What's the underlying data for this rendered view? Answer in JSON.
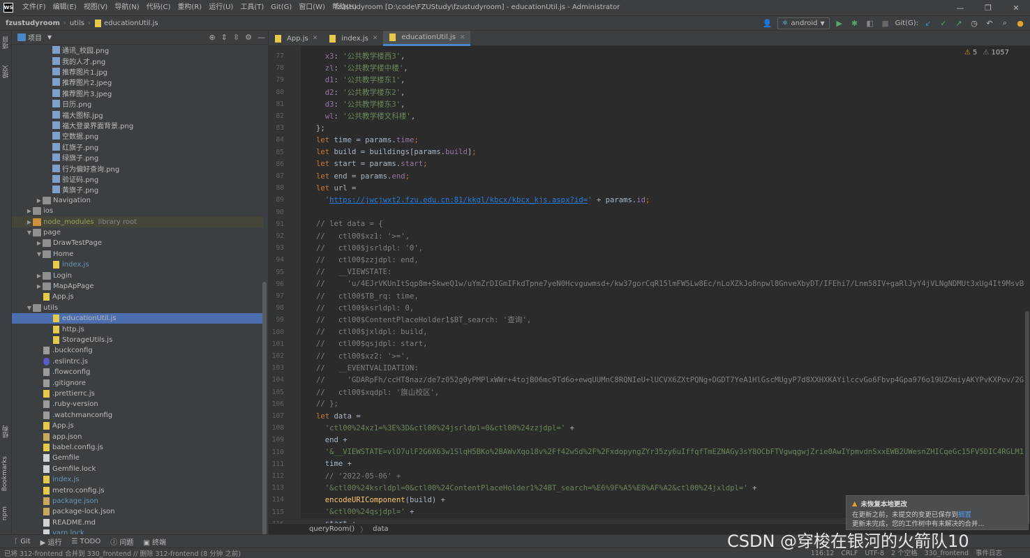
{
  "window": {
    "logo": "WS",
    "menu": [
      "文件(F)",
      "编辑(E)",
      "视图(V)",
      "导航(N)",
      "代码(C)",
      "重构(R)",
      "运行(U)",
      "工具(T)",
      "Git(G)",
      "窗口(W)",
      "帮助(H)"
    ],
    "title": "fzustudyroom [D:\\code\\FZUStudy\\fzustudyroom] - educationUtil.js - Administrator"
  },
  "navbar": {
    "crumbs": [
      "fzustudyroom",
      "utils",
      "educationUtil.js"
    ],
    "run_config": "android",
    "git_label": "Git(G):"
  },
  "left_strip": {
    "project_tab": "项目",
    "commit_tab": "提交",
    "structure_tab": "结构",
    "bookmarks_tab": "Bookmarks",
    "npm_tab": "npm"
  },
  "project_panel": {
    "title": "项目",
    "tree": [
      {
        "label": "通讯_校园.png",
        "type": "img",
        "indent": 3
      },
      {
        "label": "我的人才.png",
        "type": "img",
        "indent": 3
      },
      {
        "label": "推荐图片1.jpg",
        "type": "img",
        "indent": 3
      },
      {
        "label": "推荐图片2.jpeg",
        "type": "img",
        "indent": 3
      },
      {
        "label": "推荐图片3.jpeg",
        "type": "img",
        "indent": 3
      },
      {
        "label": "日历.png",
        "type": "img",
        "indent": 3
      },
      {
        "label": "福大图标.jpg",
        "type": "img",
        "indent": 3
      },
      {
        "label": "福大登录界面背景.png",
        "type": "img",
        "indent": 3
      },
      {
        "label": "空数据.png",
        "type": "img",
        "indent": 3
      },
      {
        "label": "红旗子.png",
        "type": "img",
        "indent": 3
      },
      {
        "label": "绿旗子.png",
        "type": "img",
        "indent": 3
      },
      {
        "label": "行为偏好查询.png",
        "type": "img",
        "indent": 3
      },
      {
        "label": "验证码.png",
        "type": "img",
        "indent": 3
      },
      {
        "label": "黄旗子.png",
        "type": "img",
        "indent": 3
      },
      {
        "label": "Navigation",
        "type": "folder",
        "indent": 2,
        "arrow": "▶"
      },
      {
        "label": "ios",
        "type": "folder",
        "indent": 1,
        "arrow": "▶"
      },
      {
        "label": "node_modules",
        "type": "folder-orange",
        "indent": 1,
        "arrow": "▶",
        "suffix": "library root",
        "lib": true
      },
      {
        "label": "page",
        "type": "folder",
        "indent": 1,
        "arrow": "▼"
      },
      {
        "label": "DrawTestPage",
        "type": "folder",
        "indent": 2,
        "arrow": "▶"
      },
      {
        "label": "Home",
        "type": "folder",
        "indent": 2,
        "arrow": "▼"
      },
      {
        "label": "index.js",
        "type": "js",
        "indent": 3,
        "blue": true
      },
      {
        "label": "Login",
        "type": "folder",
        "indent": 2,
        "arrow": "▶"
      },
      {
        "label": "MapApPage",
        "type": "folder",
        "indent": 2,
        "arrow": "▶"
      },
      {
        "label": "App.js",
        "type": "js",
        "indent": 2
      },
      {
        "label": "utils",
        "type": "folder",
        "indent": 1,
        "arrow": "▼"
      },
      {
        "label": "educationUtil.js",
        "type": "js",
        "indent": 3,
        "selected": true
      },
      {
        "label": "http.js",
        "type": "js",
        "indent": 3
      },
      {
        "label": "StorageUtils.js",
        "type": "js",
        "indent": 3
      },
      {
        "label": ".buckconfig",
        "type": "conf",
        "indent": 2
      },
      {
        "label": ".eslintrc.js",
        "type": "eslint",
        "indent": 2
      },
      {
        "label": ".flowconfig",
        "type": "conf",
        "indent": 2
      },
      {
        "label": ".gitignore",
        "type": "conf",
        "indent": 2
      },
      {
        "label": ".prettierrc.js",
        "type": "js",
        "indent": 2
      },
      {
        "label": ".ruby-version",
        "type": "conf",
        "indent": 2
      },
      {
        "label": ".watchmanconfig",
        "type": "conf",
        "indent": 2
      },
      {
        "label": "App.js",
        "type": "js",
        "indent": 2
      },
      {
        "label": "app.json",
        "type": "json",
        "indent": 2
      },
      {
        "label": "babel.config.js",
        "type": "js",
        "indent": 2
      },
      {
        "label": "Gemfile",
        "type": "file",
        "indent": 2
      },
      {
        "label": "Gemfile.lock",
        "type": "file",
        "indent": 2
      },
      {
        "label": "index.js",
        "type": "js",
        "indent": 2,
        "blue": true
      },
      {
        "label": "metro.config.js",
        "type": "js",
        "indent": 2
      },
      {
        "label": "package.json",
        "type": "json",
        "indent": 2,
        "blue": true
      },
      {
        "label": "package-lock.json",
        "type": "json",
        "indent": 2
      },
      {
        "label": "README.md",
        "type": "file",
        "indent": 2
      },
      {
        "label": "yarn.lock",
        "type": "file",
        "indent": 2,
        "blue": true
      }
    ]
  },
  "editor": {
    "tabs": [
      {
        "label": "App.js",
        "active": false
      },
      {
        "label": "index.js",
        "active": false
      },
      {
        "label": "educationUtil.js",
        "active": true
      }
    ],
    "inspections": {
      "warnings": "5",
      "weak_warnings": "1057"
    },
    "lines": [
      {
        "n": "77",
        "html": "  <span class='prop'>x3</span><span class='pl'>: </span><span class='str'>'公共教学楼西3'</span><span class='pl'>,</span>"
      },
      {
        "n": "78",
        "html": "  <span class='prop'>zl</span><span class='pl'>: </span><span class='str'>'公共教学楼中楼'</span><span class='pl'>,</span>"
      },
      {
        "n": "79",
        "html": "  <span class='prop'>d1</span><span class='pl'>: </span><span class='str'>'公共教学楼东1'</span><span class='pl'>,</span>"
      },
      {
        "n": "80",
        "html": "  <span class='prop'>d2</span><span class='pl'>: </span><span class='str'>'公共教学楼东2'</span><span class='pl'>,</span>"
      },
      {
        "n": "81",
        "html": "  <span class='prop'>d3</span><span class='pl'>: </span><span class='str'>'公共教学楼东3'</span><span class='pl'>,</span>"
      },
      {
        "n": "82",
        "html": "  <span class='prop'>wl</span><span class='pl'>: </span><span class='str'>'公共教学楼文科楼'</span><span class='pl'>,</span>"
      },
      {
        "n": "83",
        "html": "<span class='pl'>};</span>"
      },
      {
        "n": "84",
        "html": "<span class='kw'>let </span><span class='pl'>time = params.</span><span class='prop'>time</span><span class='kw'>;</span>"
      },
      {
        "n": "85",
        "html": "<span class='kw'>let </span><span class='pl'>build = buildings[params.</span><span class='prop'>build</span><span class='pl'>]</span><span class='kw'>;</span>"
      },
      {
        "n": "86",
        "html": "<span class='kw'>let </span><span class='pl'>start = params.</span><span class='prop'>start</span><span class='kw'>;</span>"
      },
      {
        "n": "87",
        "html": "<span class='kw'>let </span><span class='pl'>end = params.</span><span class='prop'>end</span><span class='kw'>;</span>"
      },
      {
        "n": "88",
        "html": "<span class='kw'>let </span><span class='pl'>url =</span>"
      },
      {
        "n": "89",
        "html": "  <span class='str'>'</span><span class='url'>https://jwcjwxt2.fzu.edu.cn:81/kkgl/kbcx/kbcx_kjs.aspx?id=</span><span class='str'>'</span><span class='pl'> + params.</span><span class='prop'>id</span><span class='kw'>;</span>"
      },
      {
        "n": "90",
        "html": ""
      },
      {
        "n": "91",
        "html": "<span class='cmt'>// let data = {</span>"
      },
      {
        "n": "92",
        "html": "<span class='cmt'>//   ctl00$xz1: '>=',</span>"
      },
      {
        "n": "93",
        "html": "<span class='cmt'>//   ctl00$jsrldpl: '0',</span>"
      },
      {
        "n": "94",
        "html": "<span class='cmt'>//   ctl00$zzjdpl: end,</span>"
      },
      {
        "n": "95",
        "html": "<span class='cmt'>//   __VIEWSTATE:</span>"
      },
      {
        "n": "96",
        "html": "<span class='cmt'>//     'u/4EJrVKUnItSqp8m+SkweQ1w/uYmZrDIGmIFkdTpne7yeN0Hcvguwmsd+/kw37gorCqR15lmFW5Lw8Ec/nLoXZkJo8npwl8GnveXbyDT/IFEhi7/Lnm58IV+gaRlJyY4jVLNgNDMUt3xUg4It9MsvBekz0z/</span>"
      },
      {
        "n": "97",
        "html": "<span class='cmt'>//   ctl00$TB_rq: time,</span>"
      },
      {
        "n": "98",
        "html": "<span class='cmt'>//   ctl00$ksrldpl: 0,</span>"
      },
      {
        "n": "99",
        "html": "<span class='cmt'>//   ctl00$ContentPlaceHolder1$BT_search: '查询',</span>"
      },
      {
        "n": "100",
        "html": "<span class='cmt'>//   ctl00$jxldpl: build,</span>"
      },
      {
        "n": "101",
        "html": "<span class='cmt'>//   ctl00$qsjdpl: start,</span>"
      },
      {
        "n": "102",
        "html": "<span class='cmt'>//   ctl00$xz2: '>=',</span>"
      },
      {
        "n": "103",
        "html": "<span class='cmt'>//   __EVENTVALIDATION:</span>"
      },
      {
        "n": "104",
        "html": "<span class='cmt'>//     'GDARpFh/ccHT8naz/de7z052g0yPMPlxWWr+4tojB06mc9Td6o+ewqUUMnC8RQNIeU+lUCVX6ZXtPQNg+DGDT7YeA1HlGscMUgyP7d8XXHXKAYilccvGo6Fbvp4Gpa976o19UZXmiyAKYPvKXPov/2G5Ldlmd</span>"
      },
      {
        "n": "105",
        "html": "<span class='cmt'>//   ctl00$xqdpl: '旗山校区',</span>"
      },
      {
        "n": "106",
        "html": "<span class='cmt'>// };</span>"
      },
      {
        "n": "107",
        "html": "<span class='kw'>let </span><span class='pl'>data =</span>"
      },
      {
        "n": "108",
        "html": "  <span class='str'>'ctl00%24xz1=%3E%3D&amp;ctl00%24jsrldpl=0&amp;ctl00%24zzjdpl='</span><span class='pl'> +</span>"
      },
      {
        "n": "109",
        "html": "  <span class='pl'>end +</span>"
      },
      {
        "n": "110",
        "html": "  <span class='str'>'&amp;__VIEWSTATE=vlO7ulF2G6X63w1SlqH5BKo%2BAWvXqo18v%2Ff42wSd%2F%2FxdopyngZYr35zy6uIffqfTmEZNAGy3sY8OCbFTVgwqgwjZrie0AwIYpmvdnSxxEWB2UWesnZHICqeGc15FV5DIC4RGLM1ZvuXie</span>"
      },
      {
        "n": "111",
        "html": "  <span class='pl'>time +</span>"
      },
      {
        "n": "112",
        "html": "  <span class='cmt'>// '2022-05-06' +</span>"
      },
      {
        "n": "113",
        "html": "  <span class='str'>'&amp;ctl00%24ksrldpl=0&amp;ctl00%24ContentPlaceHolder1%24BT_search=%E6%9F%A5%E8%AF%A2&amp;ctl00%24jxldpl='</span><span class='pl'> +</span>"
      },
      {
        "n": "114",
        "html": "  <span class='fn'>encodeURIComponent</span><span class='pl'>(build) +</span>"
      },
      {
        "n": "115",
        "html": "  <span class='str'>'&amp;ctl00%24qsjdpl='</span><span class='pl'> +</span>"
      },
      {
        "n": "116",
        "html": "  <span class='pl'>start +</span>",
        "current": true
      }
    ],
    "breadcrumb": [
      "queryRoom()",
      "data"
    ]
  },
  "bottom_tools": [
    "Git",
    "运行",
    "TODO",
    "问题",
    "终端"
  ],
  "status": {
    "message": "已将 312-frontend 合并到 330_frontend // 删除 312-frontend (8 分钟 之前)",
    "position": "116:12",
    "line_sep": "CRLF",
    "encoding": "UTF-8",
    "indent": "2 个空格",
    "branch": "330_frontend",
    "event_log": "事件日志"
  },
  "notification": {
    "title": "未恢复本地更改",
    "body_prefix": "在更新之前，未提交的变更已保存到",
    "link": "搁置",
    "body_suffix": "更新未完成，您的工作树中有未解决的合并..."
  },
  "watermark": "CSDN @穿梭在银河的火箭队10"
}
